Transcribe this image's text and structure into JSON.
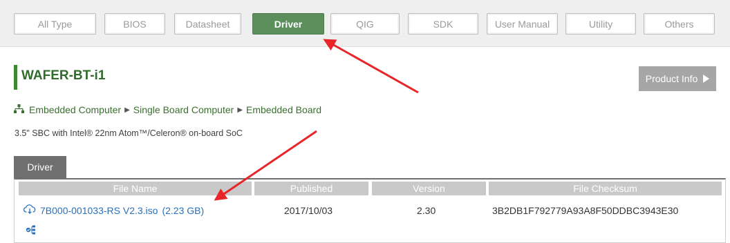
{
  "filter_tabs": [
    {
      "label": "All Type"
    },
    {
      "label": "BIOS"
    },
    {
      "label": "Datasheet"
    },
    {
      "label": "Driver",
      "active": true
    },
    {
      "label": "QIG"
    },
    {
      "label": "SDK"
    },
    {
      "label": "User Manual"
    },
    {
      "label": "Utility"
    },
    {
      "label": "Others"
    }
  ],
  "product": {
    "title": "WAFER-BT-i1",
    "info_button": "Product Info"
  },
  "breadcrumb": [
    "Embedded Computer",
    "Single Board Computer",
    "Embedded Board"
  ],
  "description": "3.5\" SBC with Intel® 22nm Atom™/Celeron® on-board SoC",
  "section_tab": "Driver",
  "table": {
    "headers": [
      "File Name",
      "Published",
      "Version",
      "File Checksum"
    ],
    "rows": [
      {
        "file": "7B000-001033-RS V2.3.iso",
        "size": "(2.23 GB)",
        "published": "2017/10/03",
        "version": "2.30",
        "checksum": "3B2DB1F792779A93A8F50DDBC3943E30"
      }
    ]
  },
  "icons": {
    "breadcrumb": "sitemap-icon",
    "download": "cloud-download-icon",
    "row_action": "network-check-icon",
    "info": "play-icon"
  },
  "colors": {
    "accent_green": "#5c8e5c",
    "title_green": "#2f6b2a",
    "link_blue": "#2a6fb8",
    "annotation_red": "#e8262a"
  }
}
